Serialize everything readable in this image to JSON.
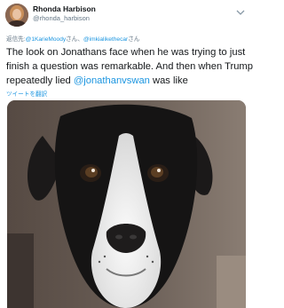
{
  "tweet": {
    "author_name": "Rhonda Harbison",
    "author_handle": "@rhonda_harbison",
    "reply": {
      "prefix": "返信先:",
      "mention1": "@1KarieMoody",
      "sep1": "さん、",
      "mention2": "@imkialikethecar",
      "suffix": "さん"
    },
    "body": {
      "line1": "The look on Jonathans face when he was trying to just",
      "line2": "finish a question was remarkable. And then when Trump",
      "line3_pre": "repeatedly lied ",
      "line3_link": "@jonathanvswan",
      "line3_post": " was like"
    },
    "translate_label": "ツイートを翻訳"
  },
  "colors": {
    "link": "#1b95e0",
    "secondary_text": "#657786",
    "primary_text": "#14171a"
  },
  "icons": {
    "menu": "chevron-down-icon"
  }
}
